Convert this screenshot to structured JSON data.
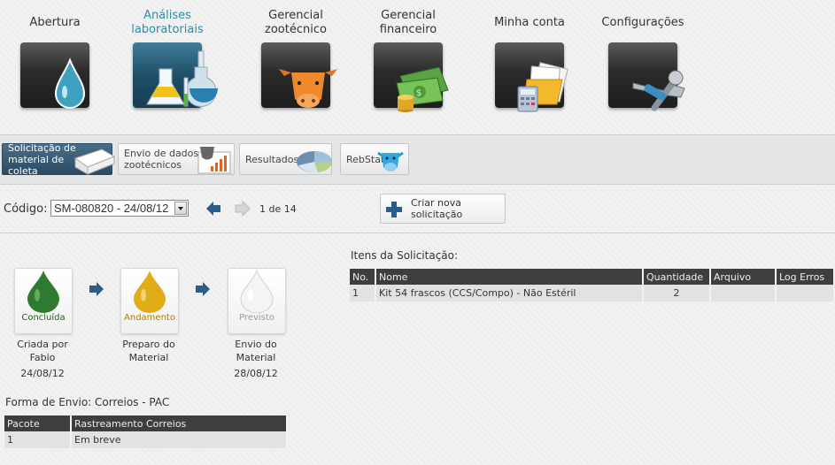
{
  "top_nav": [
    {
      "label": "Abertura",
      "icon": "water-drop-icon",
      "active": false
    },
    {
      "label": "Análises laboratoriais",
      "icon": "lab-flasks-icon",
      "active": true
    },
    {
      "label": "Gerencial zootécnico",
      "icon": "cow-head-icon",
      "active": false
    },
    {
      "label": "Gerencial financeiro",
      "icon": "money-icon",
      "active": false
    },
    {
      "label": "Minha conta",
      "icon": "folder-calculator-icon",
      "active": false
    },
    {
      "label": "Configurações",
      "icon": "wrench-tools-icon",
      "active": false
    }
  ],
  "sub_nav": [
    {
      "label": "Solicitação de material de coleta",
      "active": true
    },
    {
      "label": "Envio de dados zootécnicos",
      "active": false
    },
    {
      "label": "Resultados",
      "active": false
    },
    {
      "label": "RebStat",
      "active": false
    }
  ],
  "code_row": {
    "label": "Código:",
    "selected": "SM-080820 - 24/08/12",
    "pager": "1 de 14",
    "new_button": "Criar nova solicitação"
  },
  "steps": [
    {
      "status": "Concluída",
      "caption1": "Criada por",
      "caption2": "Fabio",
      "date": "24/08/12",
      "color": "#2f7a2f",
      "status_color": "#1f5f1f"
    },
    {
      "status": "Andamento",
      "caption1": "Preparo do",
      "caption2": "Material",
      "date": "",
      "color": "#e0ac18",
      "status_color": "#b07a00"
    },
    {
      "status": "Previsto",
      "caption1": "Envio do",
      "caption2": "Material",
      "date": "28/08/12",
      "color": "#e8e8e8",
      "status_color": "#9a9a9a"
    }
  ],
  "shipping": {
    "label": "Forma de Envio: Correios - PAC",
    "headers": [
      "Pacote",
      "Rastreamento Correios"
    ],
    "rows": [
      [
        "1",
        "Em breve"
      ]
    ]
  },
  "items": {
    "title": "Itens da Solicitação:",
    "headers": [
      "No.",
      "Nome",
      "Quantidade",
      "Arquivo",
      "Log Erros"
    ],
    "rows": [
      [
        "1",
        "Kit 54 frascos (CCS/Compo) - Não Estéril",
        "2",
        "",
        ""
      ]
    ]
  },
  "colors": {
    "active_tab": "#2e8ba8",
    "subnav_active": "#2c4a62",
    "table_header": "#3e3e3e"
  }
}
